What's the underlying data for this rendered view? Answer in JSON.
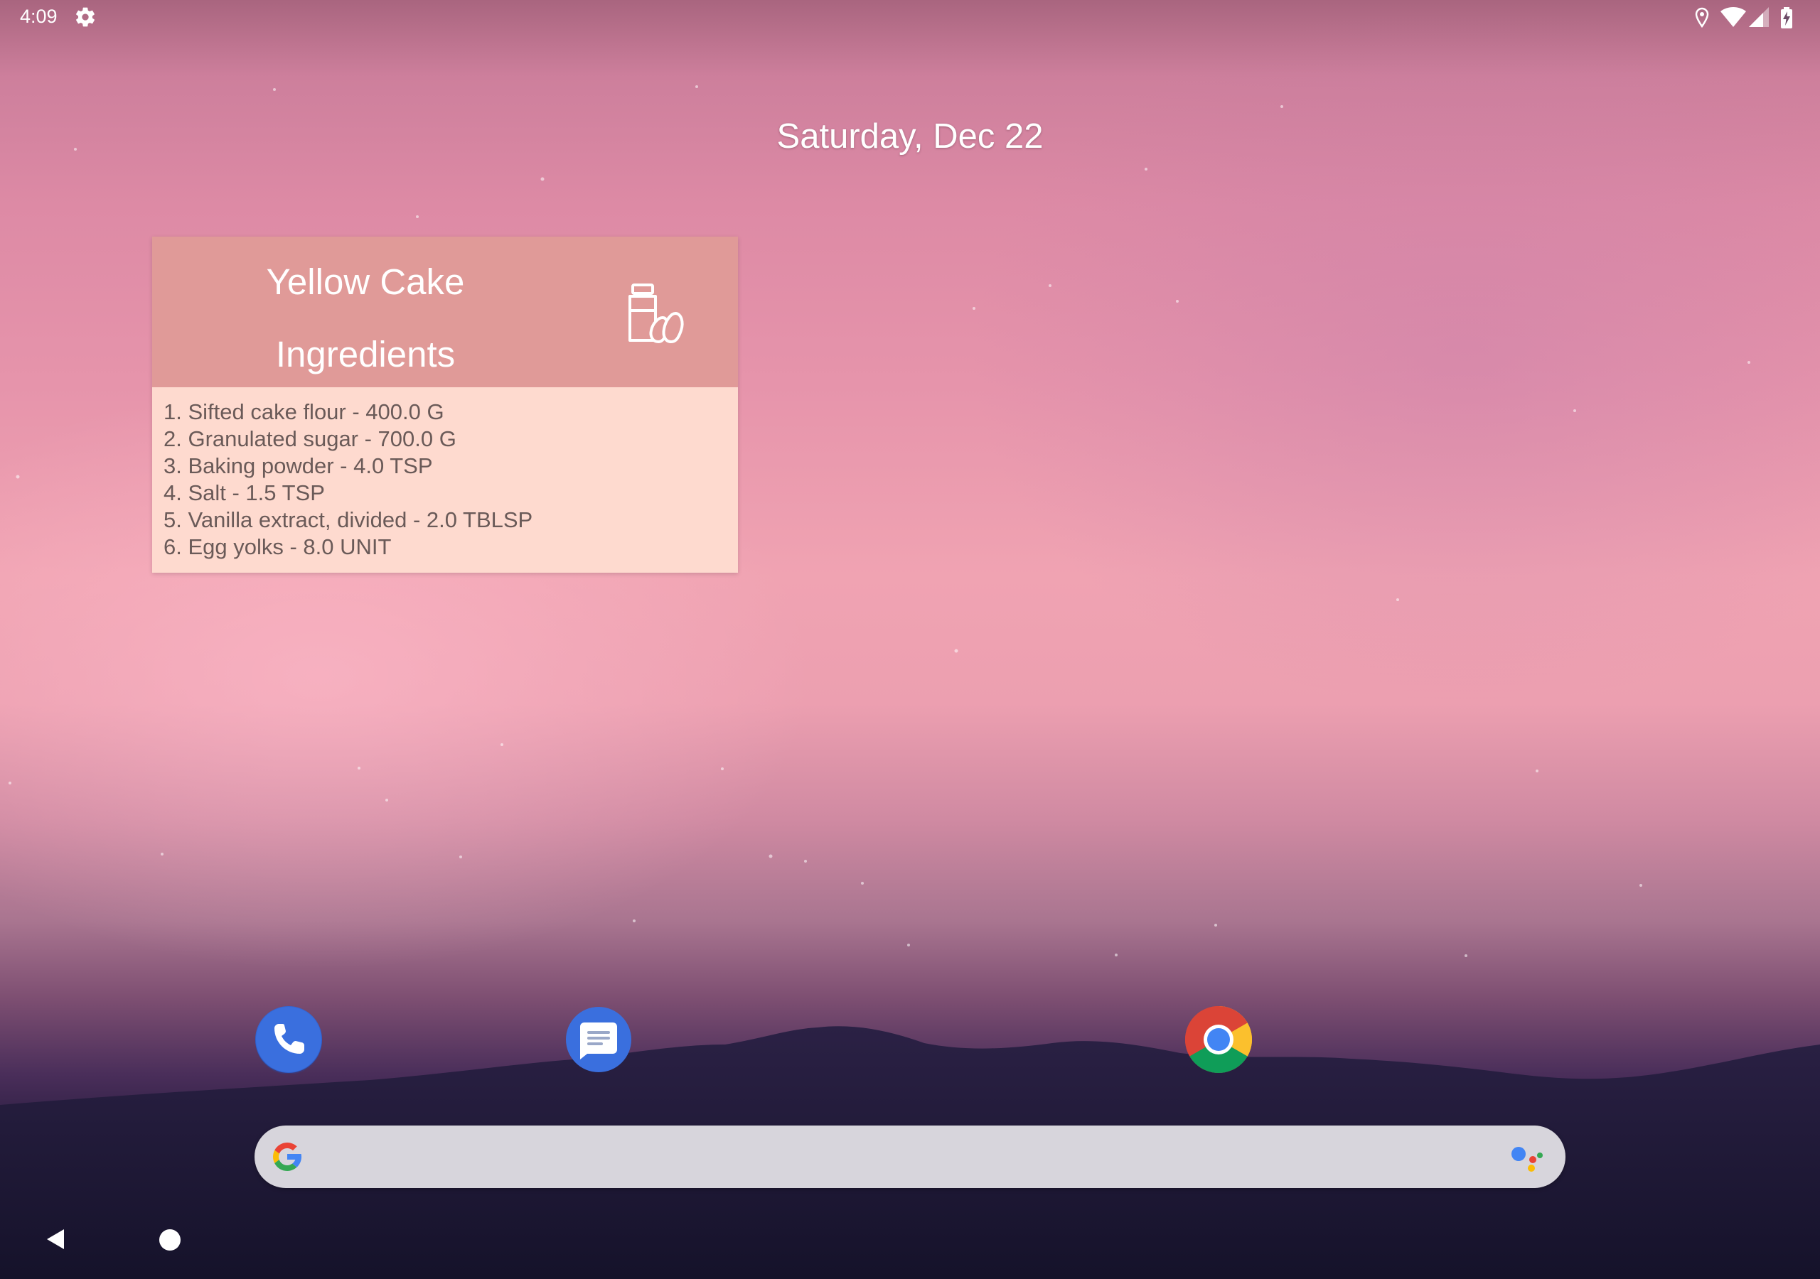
{
  "status_bar": {
    "time": "4:09",
    "left_icons": [
      "gear-icon"
    ],
    "right_icons": [
      "location-icon",
      "wifi-icon",
      "cell-signal-icon",
      "battery-charging-icon"
    ]
  },
  "home": {
    "date": "Saturday, Dec 22"
  },
  "widget": {
    "title": "Yellow Cake",
    "subtitle": "Ingredients",
    "icon": "ingredients-icon",
    "header_color": "#e09a98",
    "body_color": "#fedacf",
    "items": [
      "1. Sifted cake flour - 400.0 G",
      "2. Granulated sugar - 700.0 G",
      "3. Baking powder - 4.0 TSP",
      "4. Salt - 1.5 TSP",
      "5. Vanilla extract, divided - 2.0 TBLSP",
      "6. Egg yolks - 8.0 UNIT"
    ]
  },
  "dock": {
    "apps": [
      {
        "name": "Phone",
        "icon": "phone-icon",
        "color": "#3367d6"
      },
      {
        "name": "Messages",
        "icon": "messages-icon",
        "color": "#3367d6"
      },
      {
        "name": "Chrome",
        "icon": "chrome-icon",
        "color": "#4285f4"
      }
    ]
  },
  "search": {
    "bar_color": "#d7d5dc",
    "left_icon": "google-g-icon",
    "right_icon": "google-assistant-icon"
  },
  "nav": {
    "buttons": [
      "back-button",
      "home-button"
    ]
  }
}
